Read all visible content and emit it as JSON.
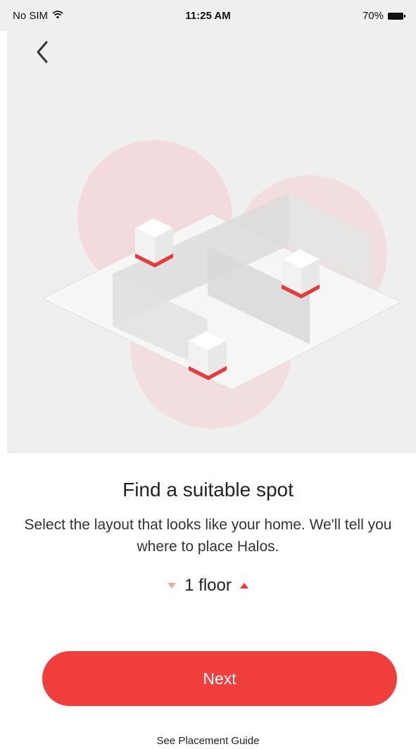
{
  "status_bar": {
    "carrier": "No SIM",
    "time": "11:25 AM",
    "battery": "70%"
  },
  "icons": {
    "back": "chevron-left-icon",
    "wifi": "wifi-icon",
    "battery": "battery-icon",
    "down": "triangle-down-icon",
    "up": "triangle-up-icon"
  },
  "content": {
    "title": "Find a suitable spot",
    "subtitle": "Select the layout that looks like your home. We'll tell you where to place Halos."
  },
  "floor_selector": {
    "value": "1 floor"
  },
  "actions": {
    "next_label": "Next",
    "guide_label": "See Placement Guide"
  },
  "colors": {
    "accent": "#ef3e3c",
    "hero_bg": "#efefef",
    "coverage": "#f4d6d8"
  }
}
